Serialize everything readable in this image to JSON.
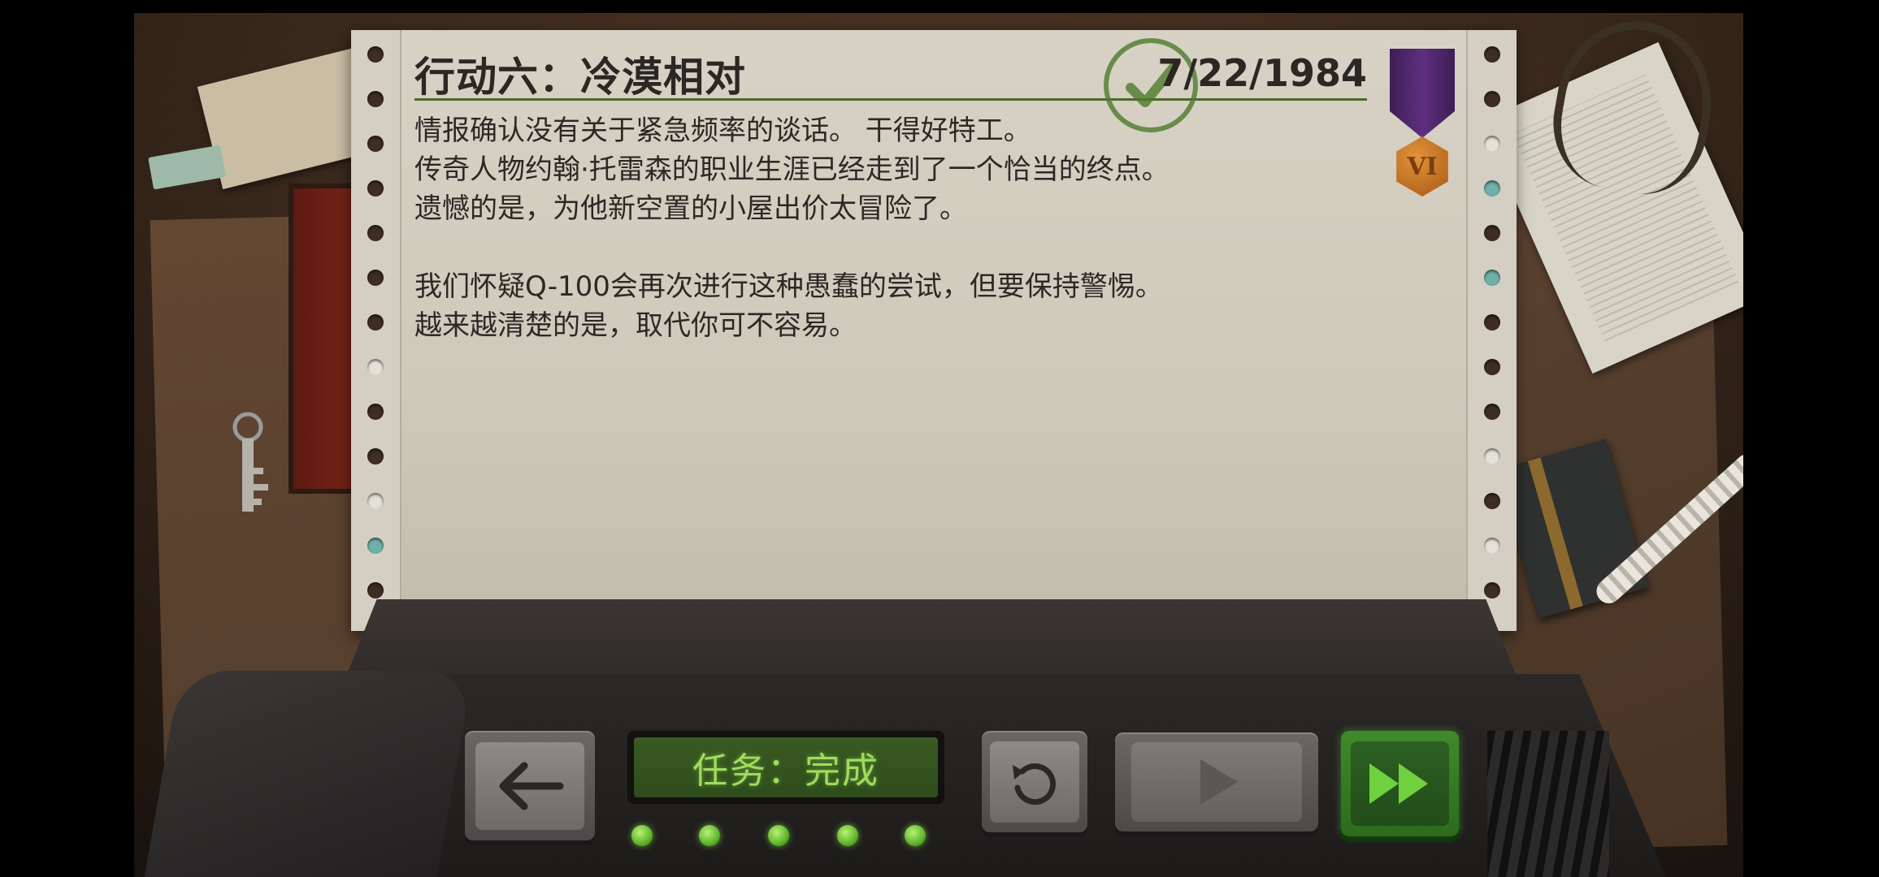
{
  "mission": {
    "title": "行动六：冷漠相对",
    "date": "7/22/1984",
    "body_lines_1": [
      "情报确认没有关于紧急频率的谈话。 干得好特工。",
      "传奇人物约翰·托雷森的职业生涯已经走到了一个恰当的终点。",
      "遗憾的是，为他新空置的小屋出价太冒险了。"
    ],
    "body_lines_2": [
      "我们怀疑Q-100会再次进行这种愚蠢的尝试，但要保持警惕。",
      "越来越清楚的是，取代你可不容易。"
    ],
    "medal_rank": "VI"
  },
  "console": {
    "status_text": "任务：完成",
    "progress_leds_lit": 5,
    "progress_leds_total": 5,
    "buttons": {
      "back": "arrow-left-icon",
      "replay": "replay-icon",
      "play": "play-icon",
      "fast_forward": "fast-forward-icon"
    }
  },
  "colors": {
    "status_text": "#9fdc5e",
    "stamp": "#4e7b2c",
    "medal_ribbon": "#5e2f80",
    "medal_badge": "#b8671e",
    "fast_forward_button": "#3f8b2a"
  }
}
